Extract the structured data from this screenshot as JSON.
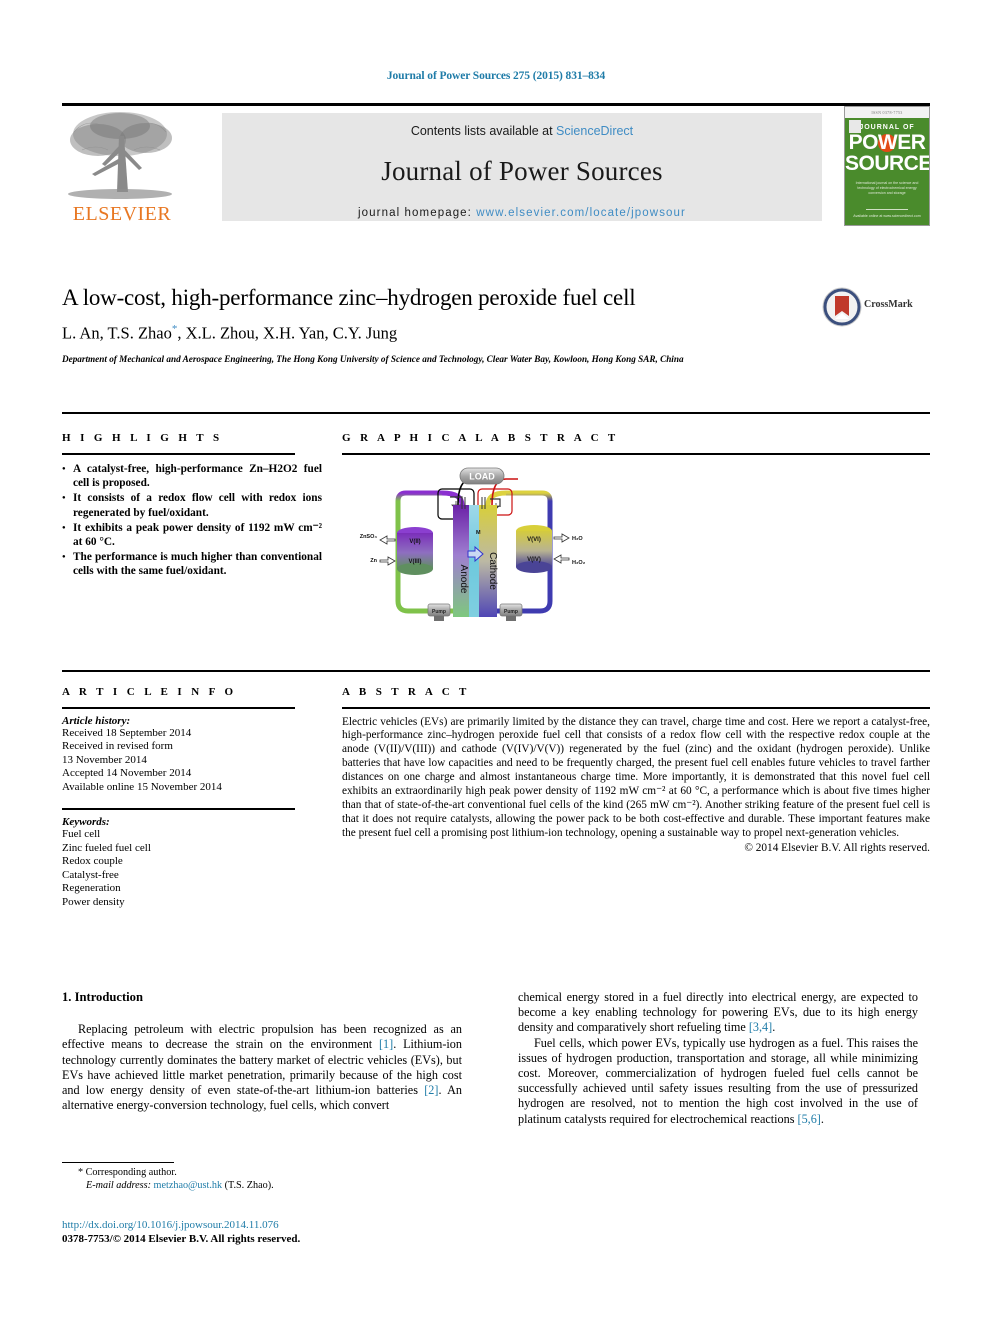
{
  "running_head": "Journal of Power Sources 275 (2015) 831–834",
  "masthead": {
    "publisher": "ELSEVIER",
    "contents_prefix": "Contents lists available at ",
    "contents_link": "ScienceDirect",
    "journal_name": "Journal of Power Sources",
    "homepage_prefix": "journal homepage: ",
    "homepage_url": "www.elsevier.com/locate/jpowsour",
    "cover": {
      "top_strip": "ISSN 0378-7753",
      "journal_of": "JOURNAL OF",
      "power": "POWER",
      "sources": "SOURCES",
      "blurb": "International journal on the science and technology of electrochemical energy conversion and storage",
      "bottom": "Available online at www.sciencedirect.com"
    }
  },
  "article": {
    "title": "A low-cost, high-performance zinc–hydrogen peroxide fuel cell",
    "authors": "L. An, T.S. Zhao",
    "authors_rest": ", X.L. Zhou, X.H. Yan, C.Y. Jung",
    "affiliation": "Department of Mechanical and Aerospace Engineering, The Hong Kong University of Science and Technology, Clear Water Bay, Kowloon, Hong Kong SAR, China",
    "crossmark_label": "CrossMark"
  },
  "highlights": {
    "heading": "H I G H L I G H T S",
    "items": [
      "A catalyst-free, high-performance Zn–H2O2 fuel cell is proposed.",
      "It consists of a redox flow cell with redox ions regenerated by fuel/oxidant.",
      "It exhibits a peak power density of 1192 mW cm⁻² at 60 °C.",
      "The performance is much higher than conventional cells with the same fuel/oxidant."
    ]
  },
  "graphical_abstract": {
    "heading": "G R A P H I C A L   A B S T R A C T",
    "diagram": {
      "load_label": "LOAD",
      "anode_label": "Anode",
      "cathode_label": "Cathode",
      "membrane_label": "M",
      "pump_left_label": "Pump",
      "pump_right_label": "Pump",
      "anode_tank_top": "V(II)",
      "anode_tank_bottom": "V(III)",
      "cathode_tank_top": "V(VI)",
      "cathode_tank_bottom": "V(IV)",
      "inlet_top_left": "ZnSO₄",
      "inlet_bottom_left": "Zn",
      "outlet_top_right": "H₂O",
      "outlet_bottom_right": "H₂O₂"
    }
  },
  "article_info": {
    "heading": "A R T I C L E   I N F O",
    "history_label": "Article history:",
    "history": [
      "Received 18 September 2014",
      "Received in revised form",
      "13 November 2014",
      "Accepted 14 November 2014",
      "Available online 15 November 2014"
    ],
    "keywords_label": "Keywords:",
    "keywords": [
      "Fuel cell",
      "Zinc fueled fuel cell",
      "Redox couple",
      "Catalyst-free",
      "Regeneration",
      "Power density"
    ]
  },
  "abstract": {
    "heading": "A B S T R A C T",
    "text": "Electric vehicles (EVs) are primarily limited by the distance they can travel, charge time and cost. Here we report a catalyst-free, high-performance zinc–hydrogen peroxide fuel cell that consists of a redox flow cell with the respective redox couple at the anode (V(II)/V(III)) and cathode (V(IV)/V(V)) regenerated by the fuel (zinc) and the oxidant (hydrogen peroxide). Unlike batteries that have low capacities and need to be frequently charged, the present fuel cell enables future vehicles to travel farther distances on one charge and almost instantaneous charge time. More importantly, it is demonstrated that this novel fuel cell exhibits an extraordinarily high peak power density of 1192 mW cm⁻² at 60 °C, a performance which is about five times higher than that of state-of-the-art conventional fuel cells of the kind (265 mW cm⁻²). Another striking feature of the present fuel cell is that it does not require catalysts, allowing the power pack to be both cost-effective and durable. These important features make the present fuel cell a promising post lithium-ion technology, opening a sustainable way to propel next-generation vehicles.",
    "copyright": "© 2014 Elsevier B.V. All rights reserved."
  },
  "body": {
    "section_heading": "1. Introduction",
    "left_paragraph_1a": "Replacing petroleum with electric propulsion has been recognized as an effective means to decrease the strain on the environment ",
    "left_ref_1": "[1]",
    "left_paragraph_1b": ". Lithium-ion technology currently dominates the battery market of electric vehicles (EVs), but EVs have achieved little market penetration, primarily because of the high cost and low energy density of even state-of-the-art lithium-ion batteries ",
    "left_ref_2": "[2]",
    "left_paragraph_1c": ". An alternative energy-conversion technology, fuel cells, which convert",
    "right_paragraph_1a": "chemical energy stored in a fuel directly into electrical energy, are expected to become a key enabling technology for powering EVs, due to its high energy density and comparatively short refueling time ",
    "right_ref_34": "[3,4]",
    "right_paragraph_1b": ".",
    "right_paragraph_2a": "Fuel cells, which power EVs, typically use hydrogen as a fuel. This raises the issues of hydrogen production, transportation and storage, all while minimizing cost. Moreover, commercialization of hydrogen fueled fuel cells cannot be successfully achieved until safety issues resulting from the use of pressurized hydrogen are resolved, not to mention the high cost involved in the use of platinum catalysts required for electrochemical reactions ",
    "right_ref_56": "[5,6]",
    "right_paragraph_2b": "."
  },
  "footer": {
    "corresponding_marker": "*",
    "corresponding_label": "Corresponding author.",
    "email_label": "E-mail address:",
    "email": "metzhao@ust.hk",
    "email_owner": "(T.S. Zhao).",
    "doi": "http://dx.doi.org/10.1016/j.jpowsour.2014.11.076",
    "issn": "0378-7753/© 2014 Elsevier B.V. All rights reserved."
  },
  "colors": {
    "link_blue": "#1f7ca8",
    "sd_blue": "#3f8cc4",
    "elsevier_orange": "#e87722",
    "cover_green": "#4a8b2c"
  }
}
